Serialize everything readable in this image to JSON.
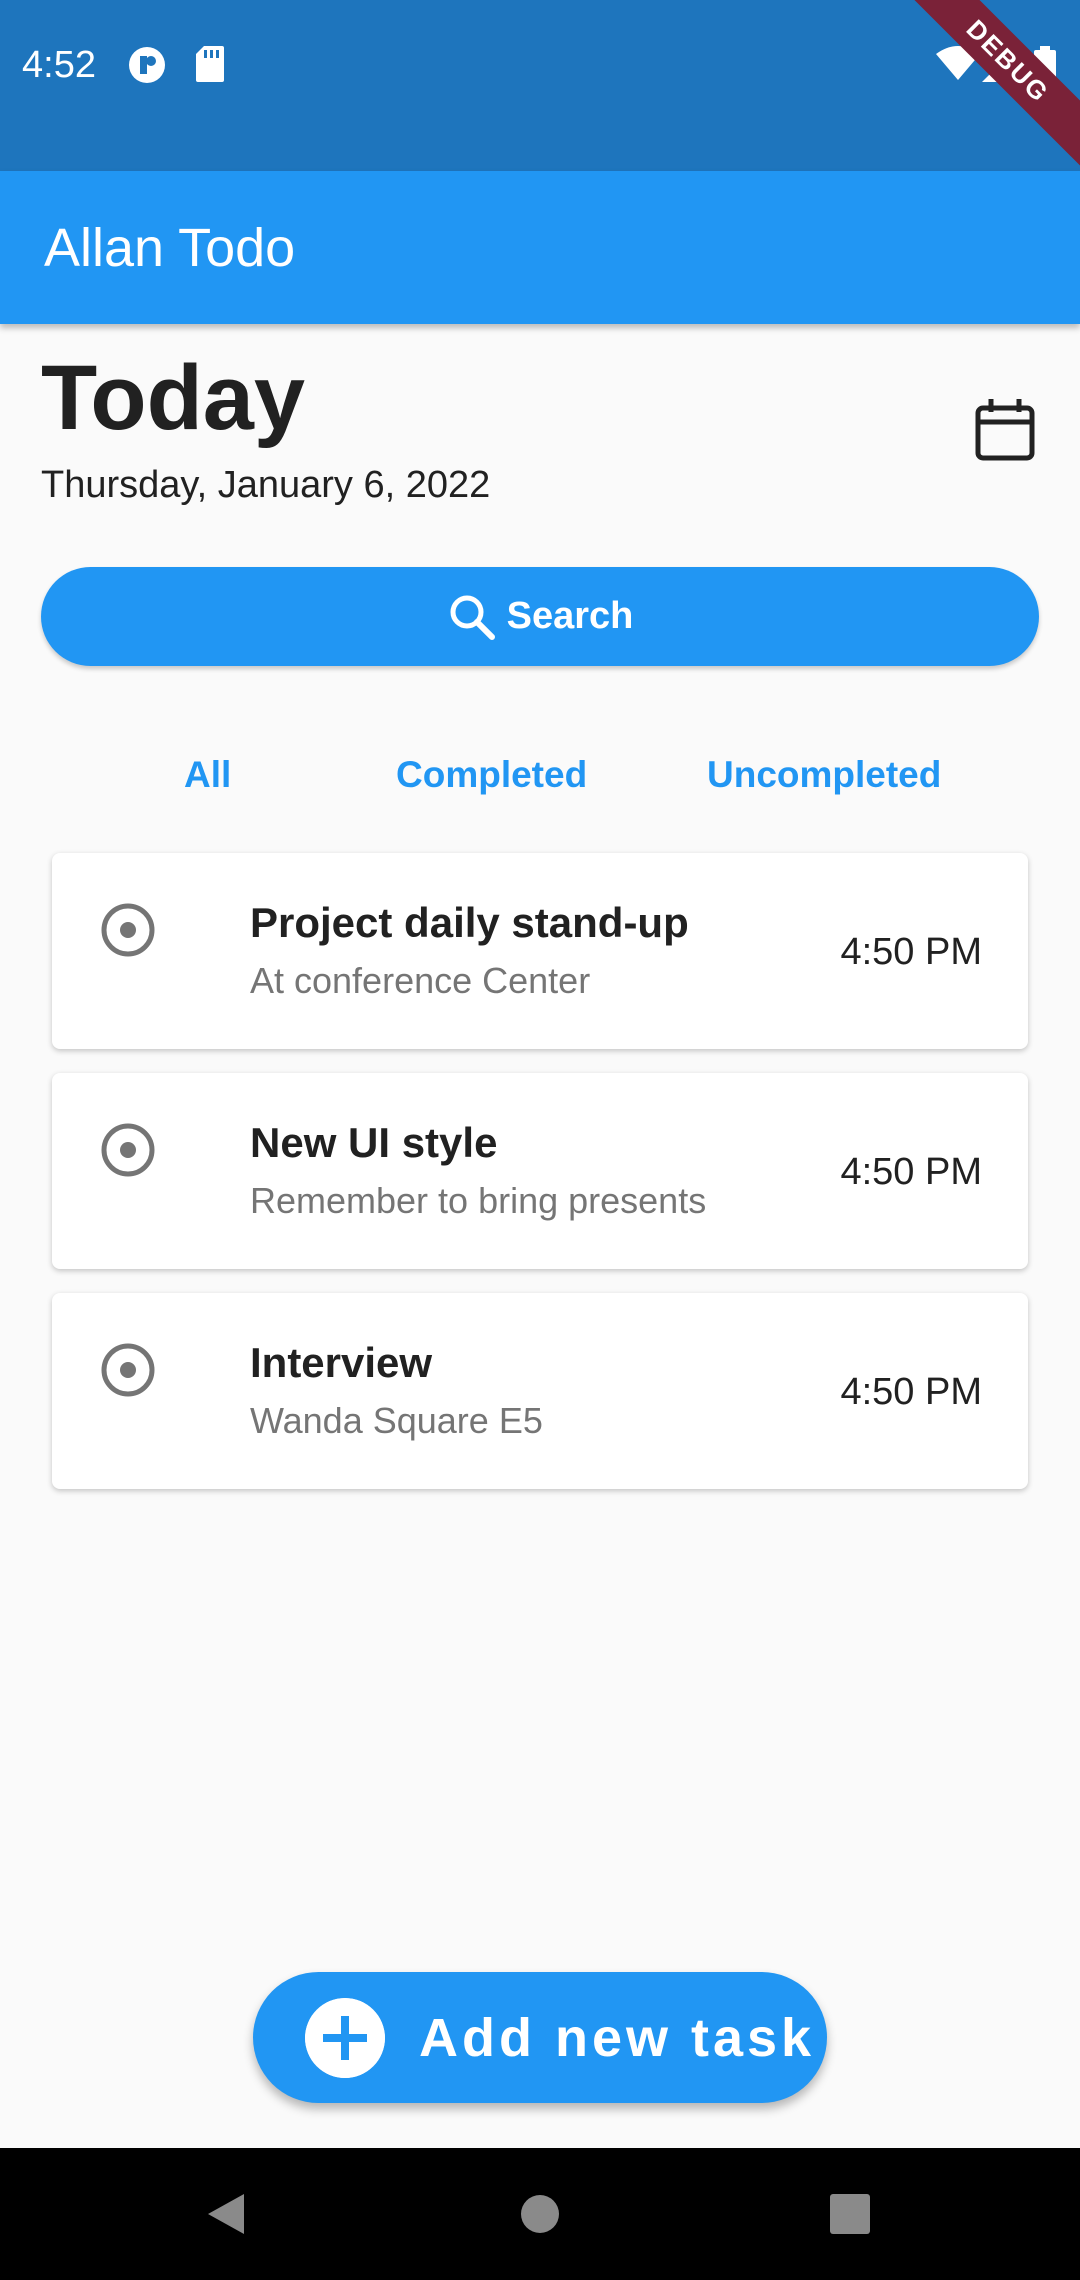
{
  "status_bar": {
    "time": "4:52",
    "icons": [
      "notification-app-icon",
      "sd-card-icon",
      "wifi-icon",
      "signal-icon",
      "battery-icon"
    ],
    "debug_banner": "DEBUG"
  },
  "app_bar": {
    "title": "Allan Todo"
  },
  "header": {
    "title": "Today",
    "date": "Thursday, January 6, 2022",
    "calendar_icon": "calendar-icon"
  },
  "search": {
    "label": "Search",
    "icon": "search-icon"
  },
  "filters": {
    "all": "All",
    "completed": "Completed",
    "uncompleted": "Uncompleted"
  },
  "tasks": [
    {
      "title": "Project daily stand-up",
      "subtitle": "At conference Center",
      "time": "4:50 PM"
    },
    {
      "title": "New UI style",
      "subtitle": "Remember to bring presents",
      "time": "4:50 PM"
    },
    {
      "title": "Interview",
      "subtitle": "Wanda Square E5",
      "time": "4:50 PM"
    }
  ],
  "fab": {
    "label": "Add new task",
    "icon": "plus-icon"
  },
  "nav_bar": {
    "icons": [
      "back-icon",
      "home-icon",
      "recents-icon"
    ]
  },
  "colors": {
    "primary": "#2196f3",
    "status_bar": "#1e75bd",
    "debug": "#7a2238"
  }
}
